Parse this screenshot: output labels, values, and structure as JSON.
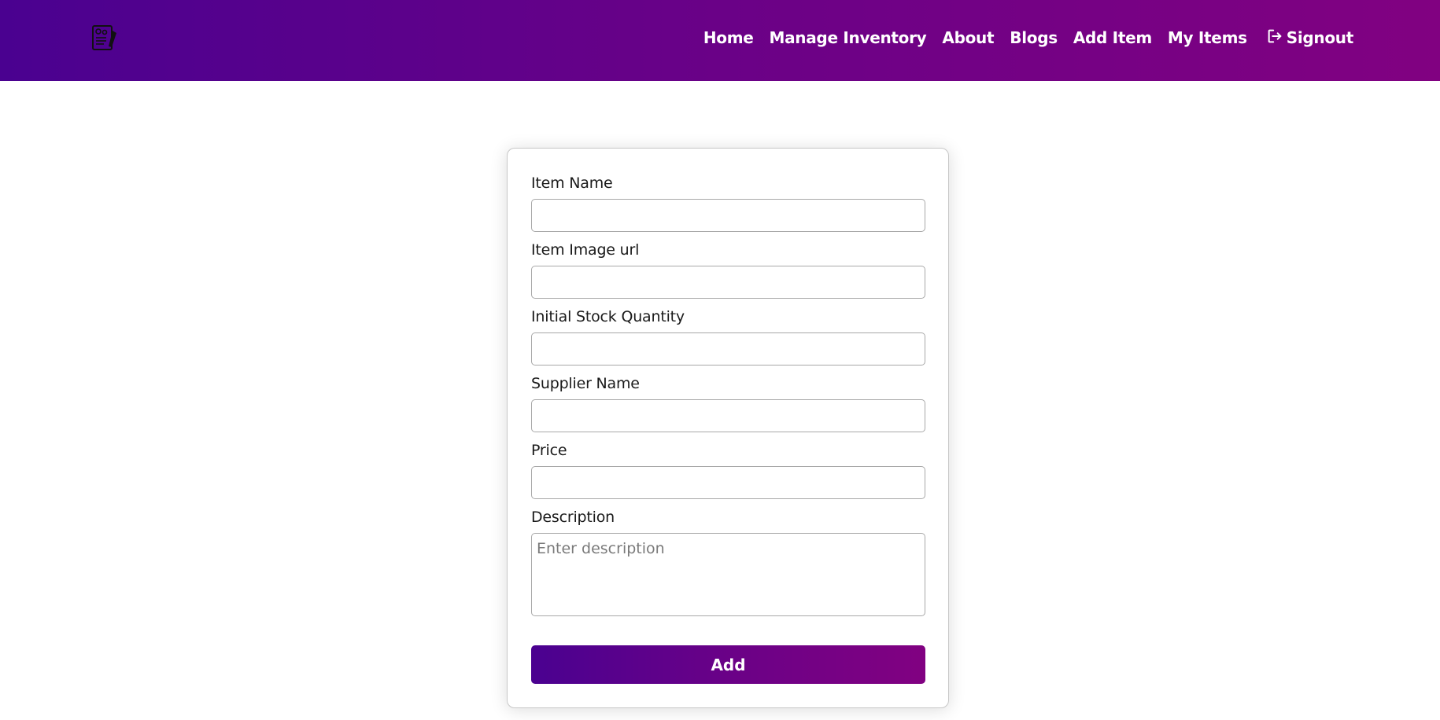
{
  "navbar": {
    "logo_icon": "inventory-document-icon",
    "links": [
      {
        "label": "Home"
      },
      {
        "label": "Manage Inventory"
      },
      {
        "label": "About"
      },
      {
        "label": "Blogs"
      },
      {
        "label": "Add Item"
      },
      {
        "label": "My Items"
      }
    ],
    "signout": {
      "label": "Signout",
      "icon": "signout-arrow-icon"
    }
  },
  "form": {
    "item_name": {
      "label": "Item Name",
      "value": ""
    },
    "item_image_url": {
      "label": "Item Image url",
      "value": ""
    },
    "initial_stock_quantity": {
      "label": "Initial Stock Quantity",
      "value": ""
    },
    "supplier_name": {
      "label": "Supplier Name",
      "value": ""
    },
    "price": {
      "label": "Price",
      "value": ""
    },
    "description": {
      "label": "Description",
      "placeholder": "Enter description",
      "value": ""
    },
    "submit_label": "Add"
  },
  "colors": {
    "brand_gradient_start": "#4a0190",
    "brand_gradient_end": "#810181",
    "text": "#1a1a1a",
    "border": "#a8a8a8"
  }
}
